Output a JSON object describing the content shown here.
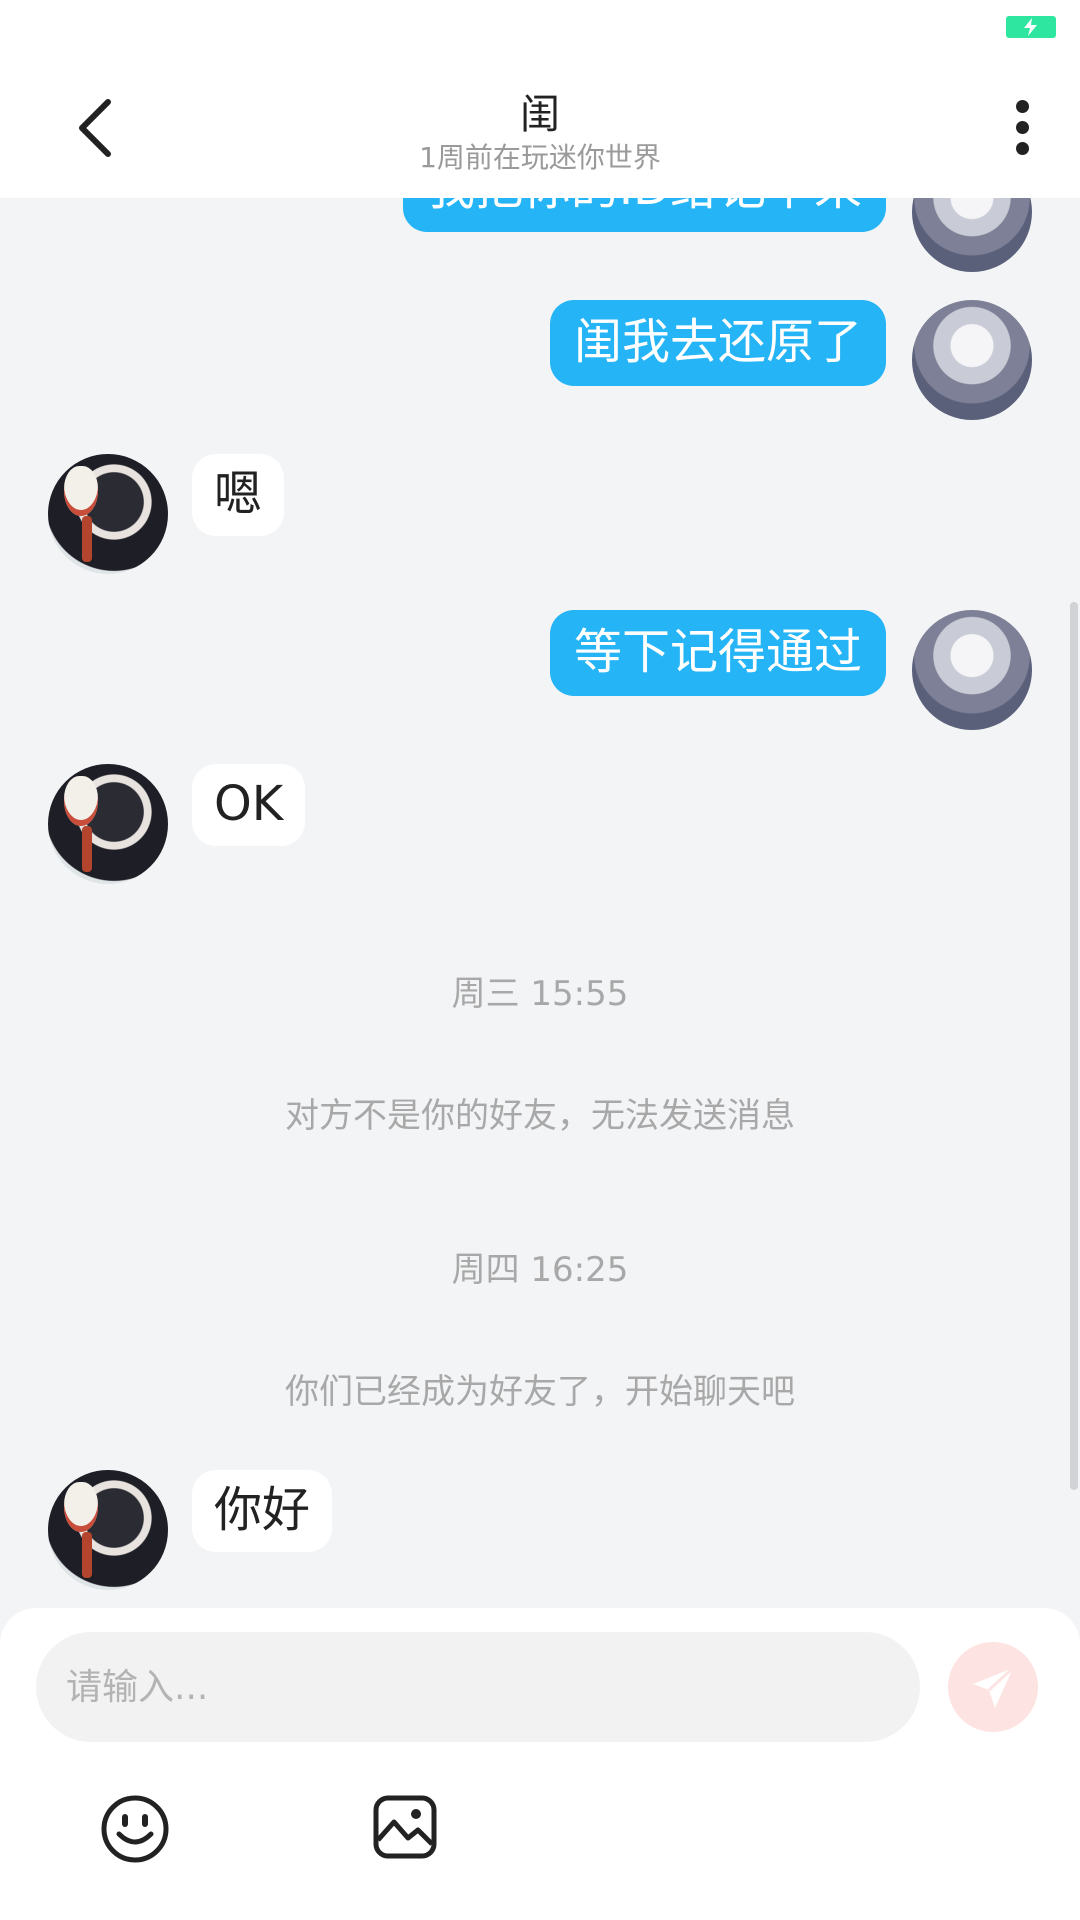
{
  "header": {
    "title": "闺",
    "subtitle": "1周前在玩迷你世界"
  },
  "messages": {
    "partial_sent": "我把你的ID给记下来",
    "sent_1": "闺我去还原了",
    "recv_1": "嗯",
    "sent_2": "等下记得通过",
    "recv_2": "OK",
    "time_1": "周三 15:55",
    "system_1": "对方不是你的好友，无法发送消息",
    "time_2": "周四 16:25",
    "system_2": "你们已经成为好友了，开始聊天吧",
    "recv_3": "你好"
  },
  "input": {
    "placeholder": "请输入..."
  },
  "icons": {
    "back": "chevron-left-icon",
    "more": "more-vertical-icon",
    "send": "paper-plane-icon",
    "emoji": "smiley-icon",
    "image": "image-icon",
    "battery": "battery-charging-icon"
  },
  "colors": {
    "accent": "#25b4f5",
    "background": "#f3f4f6",
    "send_button": "#fde3e1",
    "battery": "#2ee6a0"
  }
}
